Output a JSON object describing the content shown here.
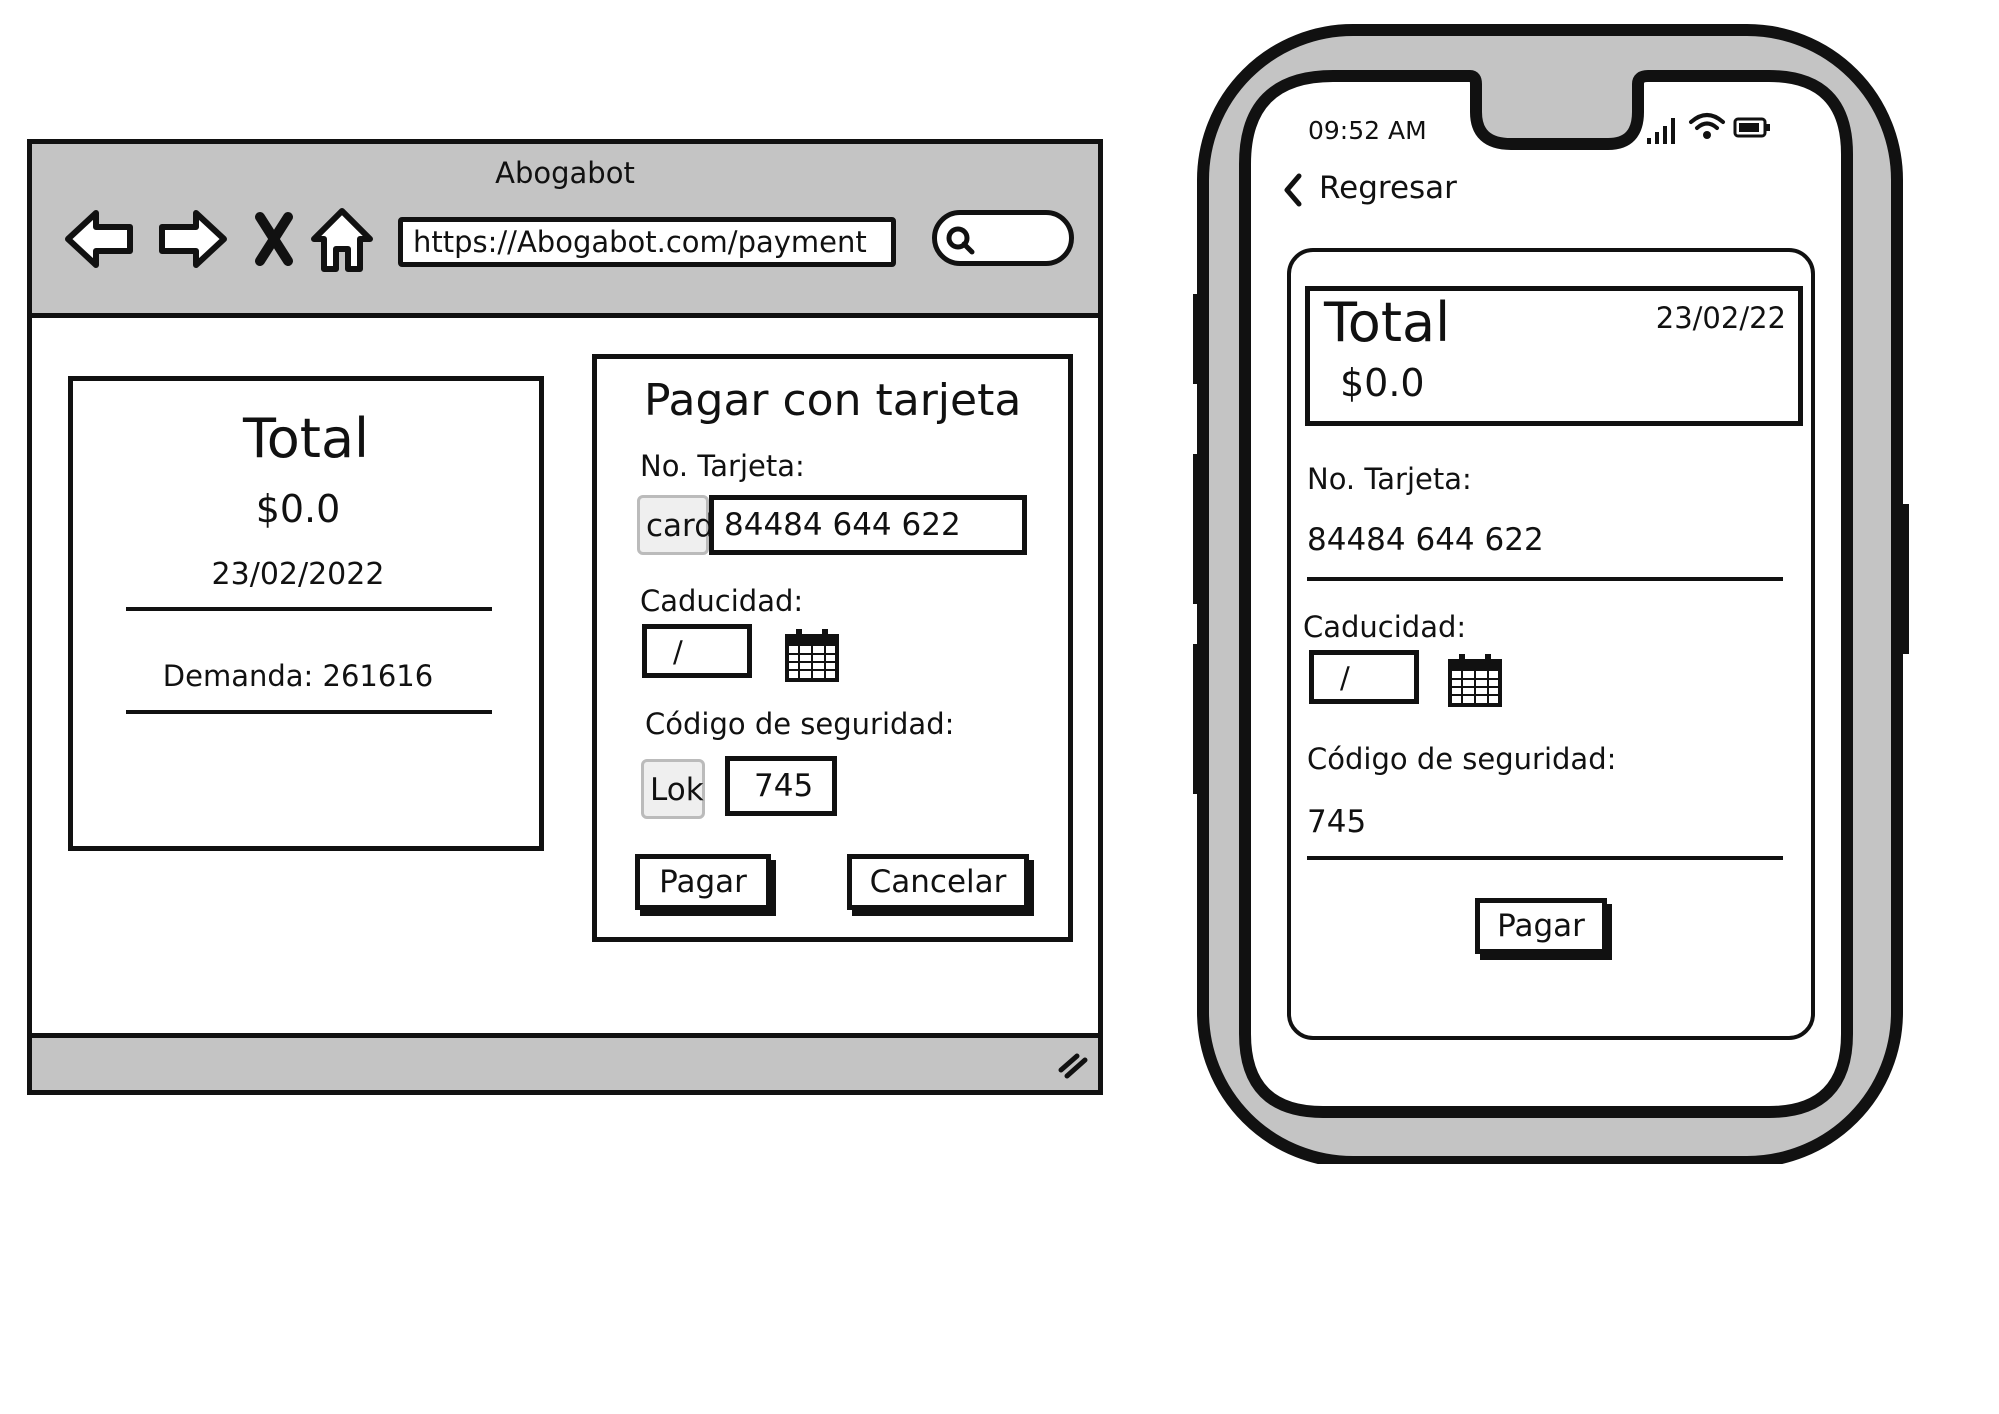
{
  "browser": {
    "title": "Abogabot",
    "url": "https://Abogabot.com/payment",
    "nav_icons": [
      "back-arrow-icon",
      "forward-arrow-icon",
      "close-x-icon",
      "home-icon"
    ],
    "search_icon": "search-icon",
    "resize_icon": "resize-grip-icon"
  },
  "summary": {
    "title": "Total",
    "amount": "$0.0",
    "date": "23/02/2022",
    "demand": "Demanda: 261616"
  },
  "payment_form": {
    "title": "Pagar con tarjeta",
    "card_label": "No. Tarjeta:",
    "card_image_label": "card",
    "card_value": "84484 644 622",
    "expiry_label": "Caducidad:",
    "expiry_value": "/",
    "security_label": "Código de seguridad:",
    "lock_image_label": "Lok",
    "security_value": "745",
    "pay_button": "Pagar",
    "cancel_button": "Cancelar"
  },
  "phone": {
    "time": "09:52 AM",
    "back_label": "Regresar",
    "total_title": "Total",
    "date": "23/02/22",
    "amount": "$0.0",
    "card_label": "No. Tarjeta:",
    "card_value": "84484 644 622",
    "expiry_label": "Caducidad:",
    "expiry_value": "/",
    "security_label": "Código de seguridad:",
    "security_value": "745",
    "pay_button": "Pagar"
  },
  "colors": {
    "chrome_gray": "#c4c4c4",
    "ink": "#111111",
    "background": "#ffffff"
  }
}
